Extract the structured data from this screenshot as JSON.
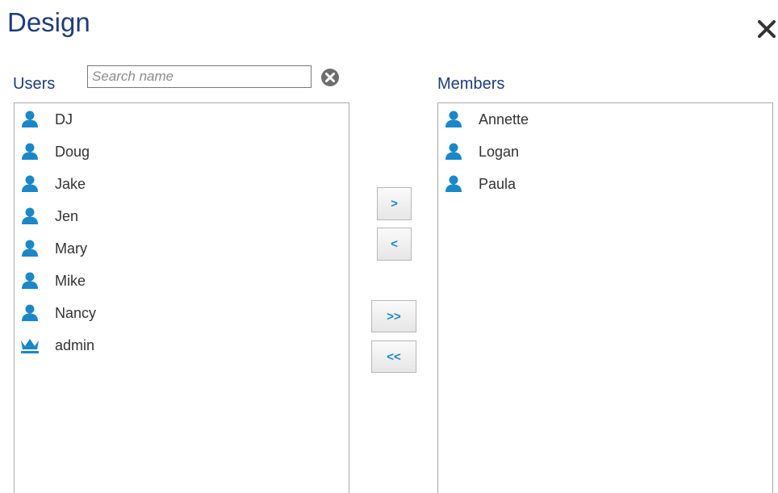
{
  "dialog": {
    "title": "Design",
    "close_icon": "close-icon"
  },
  "users": {
    "label": "Users",
    "search": {
      "placeholder": "Search name",
      "value": ""
    },
    "clear_icon": "clear-circle-icon",
    "items": [
      {
        "label": "DJ",
        "icon": "user-icon"
      },
      {
        "label": "Doug",
        "icon": "user-icon"
      },
      {
        "label": "Jake",
        "icon": "user-icon"
      },
      {
        "label": "Jen",
        "icon": "user-icon"
      },
      {
        "label": "Mary",
        "icon": "user-icon"
      },
      {
        "label": "Mike",
        "icon": "user-icon"
      },
      {
        "label": "Nancy",
        "icon": "user-icon"
      },
      {
        "label": "admin",
        "icon": "crown-icon"
      }
    ]
  },
  "members": {
    "label": "Members",
    "items": [
      {
        "label": "Annette",
        "icon": "user-icon"
      },
      {
        "label": "Logan",
        "icon": "user-icon"
      },
      {
        "label": "Paula",
        "icon": "user-icon"
      }
    ]
  },
  "buttons": {
    "add": ">",
    "remove": "<",
    "add_all": ">>",
    "remove_all": "<<"
  },
  "colors": {
    "title": "#1f3d7a",
    "icon_blue": "#1a87c9",
    "button_text": "#1a87c9"
  }
}
